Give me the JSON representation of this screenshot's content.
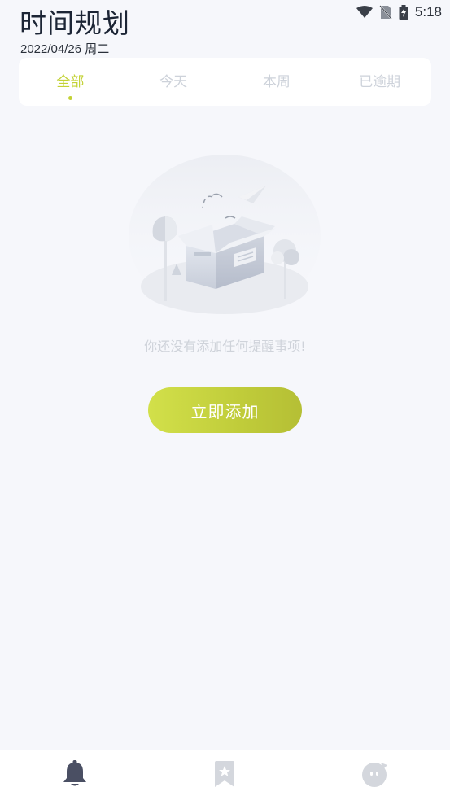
{
  "status_bar": {
    "time": "5:18",
    "icons": [
      "wifi-icon",
      "no-sim-icon",
      "battery-charging-icon"
    ]
  },
  "header": {
    "title": "时间规划",
    "date": "2022/04/26 周二"
  },
  "tabs": [
    {
      "label": "全部",
      "active": true
    },
    {
      "label": "今天",
      "active": false
    },
    {
      "label": "本周",
      "active": false
    },
    {
      "label": "已逾期",
      "active": false
    }
  ],
  "empty_state": {
    "illustration": "empty-box-illustration",
    "message": "你还没有添加任何提醒事项!",
    "action_label": "立即添加"
  },
  "bottom_nav": {
    "items": [
      {
        "icon": "bell-icon",
        "active": true
      },
      {
        "icon": "bookmark-star-icon",
        "active": false
      },
      {
        "icon": "profile-face-icon",
        "active": false
      }
    ]
  },
  "colors": {
    "accent": "#c3d236",
    "background": "#f6f7fb",
    "inactive_tab": "#cdd2da",
    "nav_active": "#4a4f63",
    "nav_inactive": "#d4d7dd"
  }
}
